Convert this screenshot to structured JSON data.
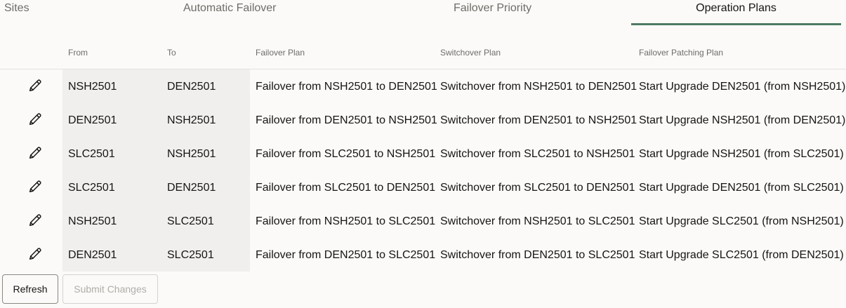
{
  "tabs": [
    {
      "label": "Sites",
      "selected": false
    },
    {
      "label": "Automatic Failover",
      "selected": false
    },
    {
      "label": "Failover Priority",
      "selected": false
    },
    {
      "label": "Operation Plans",
      "selected": true
    }
  ],
  "accent_color": "#4e7a63",
  "table": {
    "headers": {
      "from": "From",
      "to": "To",
      "failover_plan": "Failover Plan",
      "switchover_plan": "Switchover Plan",
      "failover_patching_plan": "Failover Patching Plan"
    },
    "edit_icon": "pencil-icon",
    "rows": [
      {
        "from": "NSH2501",
        "to": "DEN2501",
        "failover_plan": "Failover from NSH2501 to DEN2501",
        "switchover_plan": "Switchover from NSH2501 to DEN2501",
        "failover_patching_plan": "Start Upgrade DEN2501 (from NSH2501)"
      },
      {
        "from": "DEN2501",
        "to": "NSH2501",
        "failover_plan": "Failover from DEN2501 to NSH2501",
        "switchover_plan": "Switchover from DEN2501 to NSH2501",
        "failover_patching_plan": "Start Upgrade NSH2501 (from DEN2501)"
      },
      {
        "from": "SLC2501",
        "to": "NSH2501",
        "failover_plan": "Failover from SLC2501 to NSH2501",
        "switchover_plan": "Switchover from SLC2501 to NSH2501",
        "failover_patching_plan": "Start Upgrade NSH2501 (from SLC2501)"
      },
      {
        "from": "SLC2501",
        "to": "DEN2501",
        "failover_plan": "Failover from SLC2501 to DEN2501",
        "switchover_plan": "Switchover from SLC2501 to DEN2501",
        "failover_patching_plan": "Start Upgrade DEN2501 (from SLC2501)"
      },
      {
        "from": "NSH2501",
        "to": "SLC2501",
        "failover_plan": "Failover from NSH2501 to SLC2501",
        "switchover_plan": "Switchover from NSH2501 to SLC2501",
        "failover_patching_plan": "Start Upgrade SLC2501 (from NSH2501)"
      },
      {
        "from": "DEN2501",
        "to": "SLC2501",
        "failover_plan": "Failover from DEN2501 to SLC2501",
        "switchover_plan": "Switchover from DEN2501 to SLC2501",
        "failover_patching_plan": "Start Upgrade SLC2501 (from DEN2501)"
      }
    ]
  },
  "buttons": {
    "refresh": {
      "label": "Refresh",
      "enabled": true
    },
    "submit": {
      "label": "Submit Changes",
      "enabled": false
    }
  }
}
